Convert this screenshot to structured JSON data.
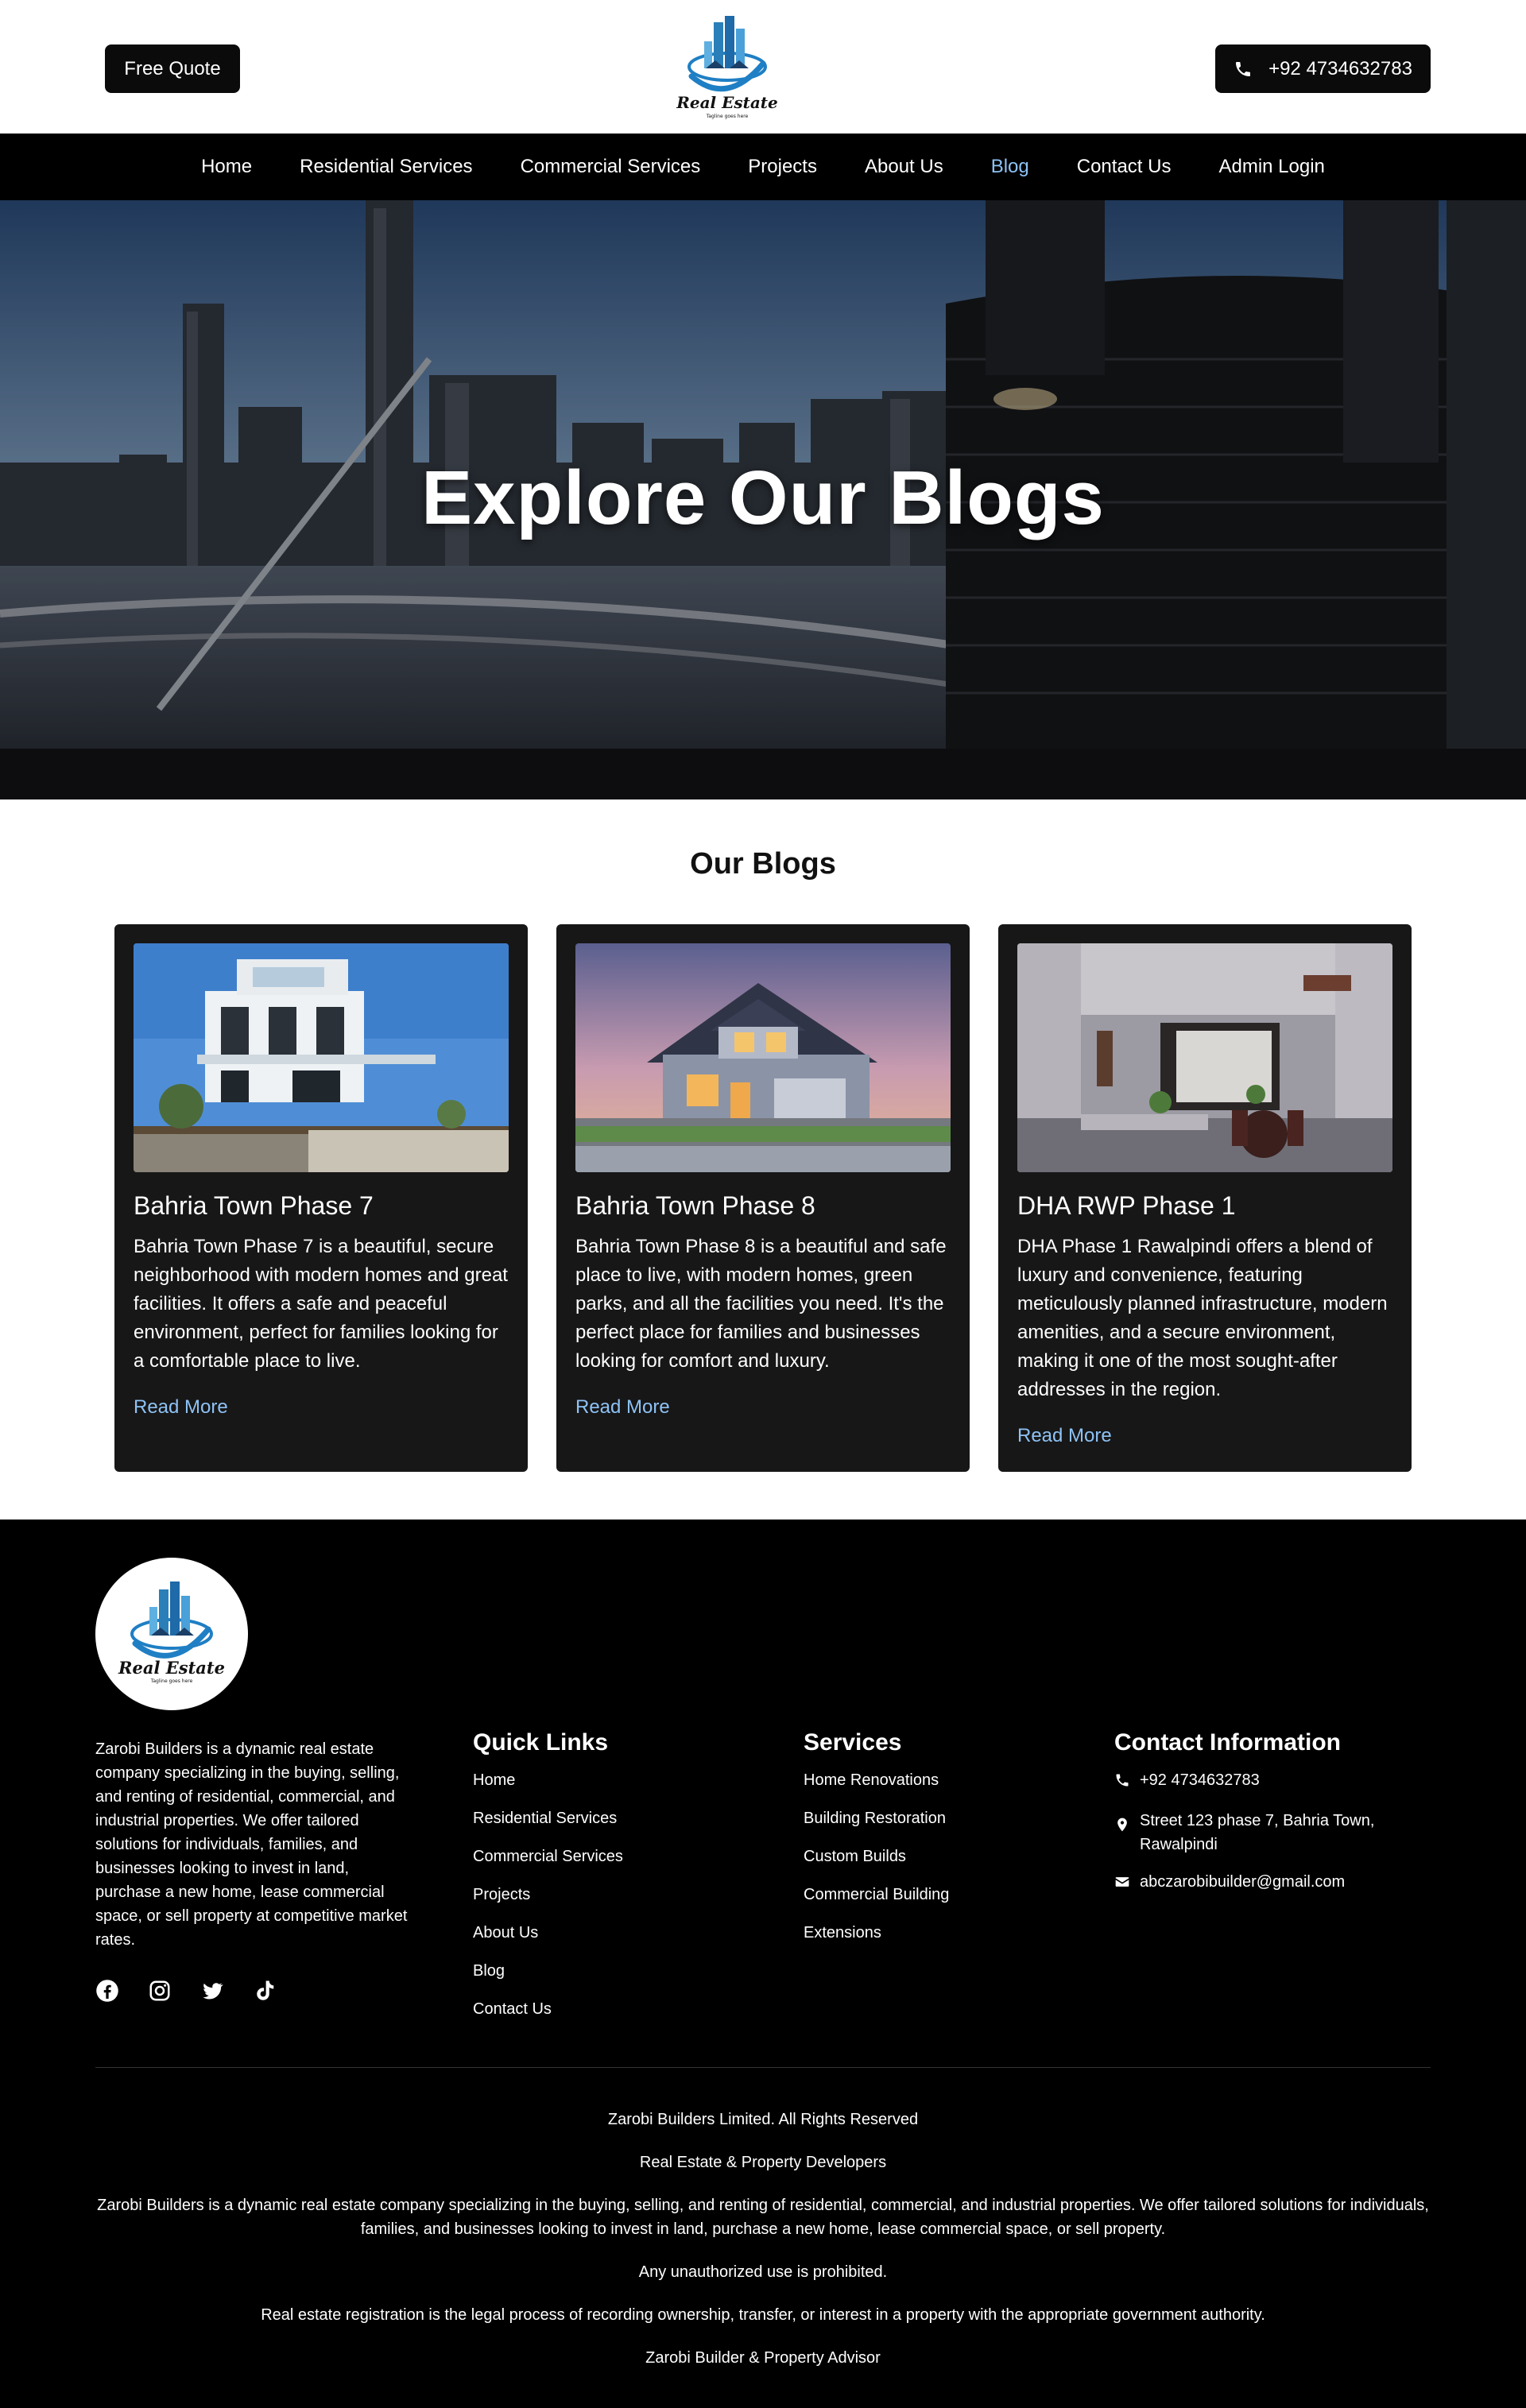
{
  "header": {
    "quote_label": "Free Quote",
    "phone_label": "+92 4734632783",
    "logo": {
      "brand": "Real Estate",
      "tagline": "Tagline goes here"
    }
  },
  "nav": {
    "items": [
      "Home",
      "Residential Services",
      "Commercial Services",
      "Projects",
      "About Us",
      "Blog",
      "Contact Us",
      "Admin Login"
    ],
    "active": "Blog"
  },
  "hero": {
    "title": "Explore Our Blogs"
  },
  "blogs": {
    "heading_prefix": "Our",
    "heading_bold": "Blogs",
    "cards": [
      {
        "title": "Bahria Town Phase 7",
        "text": "Bahria Town Phase 7 is a beautiful, secure neighborhood with modern homes and great facilities. It offers a safe and peaceful environment, perfect for families looking for a comfortable place to live.",
        "link": "Read More"
      },
      {
        "title": "Bahria Town Phase 8",
        "text": "Bahria Town Phase 8 is a beautiful and safe place to live, with modern homes, green parks, and all the facilities you need. It's the perfect place for families and businesses looking for comfort and luxury.",
        "link": "Read More"
      },
      {
        "title": "DHA RWP Phase 1",
        "text": "DHA Phase 1 Rawalpindi offers a blend of luxury and convenience, featuring meticulously planned infrastructure, modern amenities, and a secure environment, making it one of the most sought-after addresses in the region.",
        "link": "Read More"
      }
    ]
  },
  "footer": {
    "about": "Zarobi Builders is a dynamic real estate company specializing in the buying, selling, and renting of residential, commercial, and industrial properties. We offer tailored solutions for individuals, families, and businesses looking to invest in land, purchase a new home, lease commercial space, or sell property at competitive market rates.",
    "socials": [
      "facebook-icon",
      "instagram-icon",
      "twitter-icon",
      "tiktok-icon"
    ],
    "quick_links": {
      "title": "Quick Links",
      "items": [
        "Home",
        "Residential Services",
        "Commercial Services",
        "Projects",
        "About Us",
        "Blog",
        "Contact Us"
      ]
    },
    "services": {
      "title": "Services",
      "items": [
        "Home Renovations",
        "Building Restoration",
        "Custom Builds",
        "Commercial Building",
        "Extensions"
      ]
    },
    "contact": {
      "title": "Contact Information",
      "phone": "+92 4734632783",
      "address": "Street 123 phase 7, Bahria Town, Rawalpindi",
      "email": "abczarobibuilder@gmail.com"
    },
    "bottom": [
      "Zarobi Builders Limited. All Rights Reserved",
      "Real Estate & Property Developers",
      "Zarobi Builders is a dynamic real estate company specializing in the buying, selling, and renting of residential, commercial, and industrial properties. We offer tailored solutions for individuals, families, and businesses looking to invest in land, purchase a new home, lease commercial space, or sell property.",
      "Any unauthorized use is prohibited.",
      "Real estate registration is the legal process of recording ownership, transfer, or interest in a property with the appropriate government authority.",
      "Zarobi Builder & Property Advisor"
    ]
  },
  "colors": {
    "dark": "#0b0b0b",
    "card": "#171717",
    "link": "#8ec2f5",
    "logo_blue": "#1f7fc4"
  }
}
